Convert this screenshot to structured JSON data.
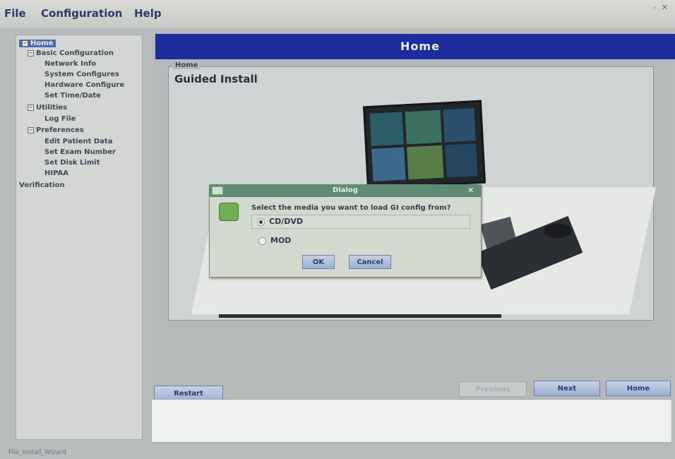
{
  "menu": {
    "file": "File",
    "configuration": "Configuration",
    "help": "Help",
    "window_controls": "- ✕"
  },
  "sidebar": {
    "items": [
      {
        "label": "Home",
        "level": 0,
        "selected": true,
        "toggle": "−"
      },
      {
        "label": "Basic Configuration",
        "level": 1,
        "selected": false,
        "toggle": "−"
      },
      {
        "label": "Network Info",
        "level": 2,
        "selected": false
      },
      {
        "label": "System Configures",
        "level": 2,
        "selected": false
      },
      {
        "label": "Hardware Configure",
        "level": 2,
        "selected": false
      },
      {
        "label": "Set Time/Date",
        "level": 2,
        "selected": false
      },
      {
        "label": "Utilities",
        "level": 1,
        "selected": false,
        "toggle": "−"
      },
      {
        "label": "Log File",
        "level": 2,
        "selected": false
      },
      {
        "label": "Preferences",
        "level": 1,
        "selected": false,
        "toggle": "−"
      },
      {
        "label": "Edit Patient Data",
        "level": 2,
        "selected": false
      },
      {
        "label": "Set Exam Number",
        "level": 2,
        "selected": false
      },
      {
        "label": "Set Disk Limit",
        "level": 2,
        "selected": false
      },
      {
        "label": "HIPAA",
        "level": 2,
        "selected": false
      },
      {
        "label": "Verification",
        "level": 1,
        "selected": false
      }
    ]
  },
  "main": {
    "banner_title": "Home",
    "frame_legend": "Home",
    "frame_title": "Guided Install"
  },
  "dialog": {
    "title": "Dialog",
    "close_glyph": "✕",
    "question": "Select the media you want to load GI config from?",
    "options": [
      {
        "label": "CD/DVD",
        "selected": true
      },
      {
        "label": "MOD",
        "selected": false
      }
    ],
    "ok_label": "OK",
    "cancel_label": "Cancel"
  },
  "nav": {
    "restart_label": "Restart",
    "previous_label": "Previous",
    "next_label": "Next",
    "home_label": "Home"
  },
  "status_text": "File_Install_Wizard",
  "colors": {
    "banner": "#1d2d9d",
    "dialog_title": "#5f8a73",
    "selection": "#4c6ab0",
    "button": "#9fb0d4"
  }
}
